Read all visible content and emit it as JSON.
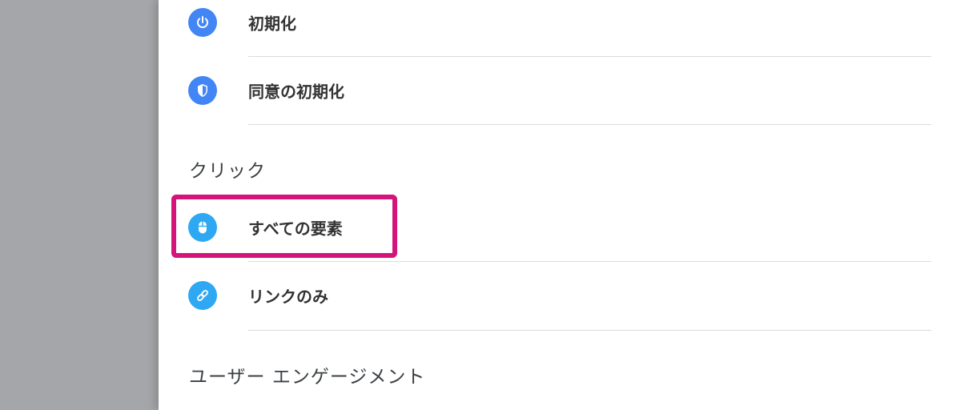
{
  "colors": {
    "backdrop": "#a5a6a9",
    "panel": "#ffffff",
    "icon_blue": "#4285f4",
    "icon_light_blue": "#2ea8f2",
    "highlight": "#d4147b"
  },
  "items": [
    {
      "label": "初期化",
      "icon": "power-icon"
    },
    {
      "label": "同意の初期化",
      "icon": "shield-icon"
    },
    {
      "label": "すべての要素",
      "icon": "mouse-icon"
    },
    {
      "label": "リンクのみ",
      "icon": "link-icon"
    }
  ],
  "sections": {
    "click": "クリック",
    "engagement": "ユーザー エンゲージメント"
  }
}
